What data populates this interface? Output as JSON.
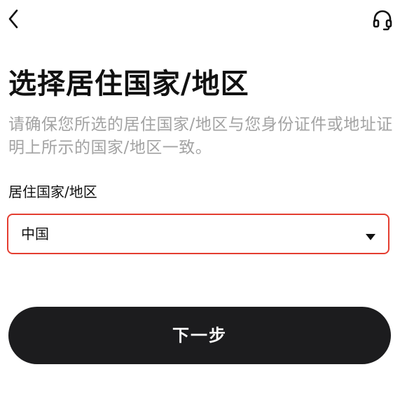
{
  "header": {
    "back_icon": "chevron-left-icon",
    "support_icon": "headset-icon"
  },
  "page": {
    "title": "选择居住国家/地区",
    "subtitle": "请确保您所选的居住国家/地区与您身份证件或地址证明上所示的国家/地区一致。"
  },
  "form": {
    "country_label": "居住国家/地区",
    "country_value": "中国",
    "dropdown_icon": "caret-down-icon",
    "highlight_color": "#e43d30"
  },
  "actions": {
    "next_label": "下一步",
    "button_color": "#1c1c1e"
  }
}
